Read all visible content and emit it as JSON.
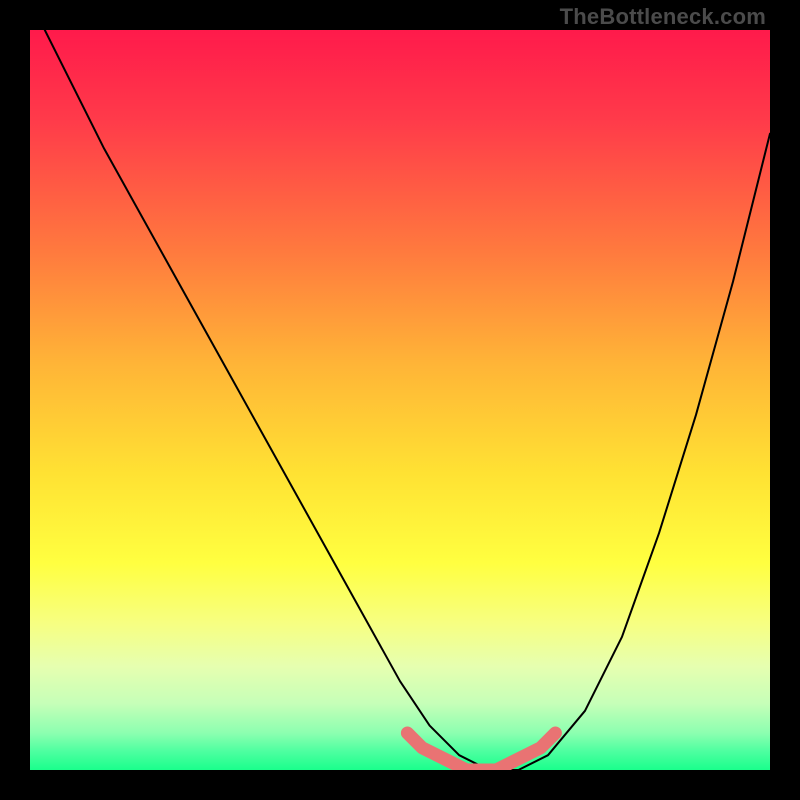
{
  "watermark": "TheBottleneck.com",
  "chart_data": {
    "type": "line",
    "title": "",
    "xlabel": "",
    "ylabel": "",
    "xlim": [
      0,
      100
    ],
    "ylim": [
      0,
      100
    ],
    "grid": false,
    "legend": false,
    "background_gradient_stops": [
      {
        "offset": 0.0,
        "color": "#ff1a4b"
      },
      {
        "offset": 0.12,
        "color": "#ff3a4a"
      },
      {
        "offset": 0.3,
        "color": "#ff7a3e"
      },
      {
        "offset": 0.45,
        "color": "#ffb437"
      },
      {
        "offset": 0.6,
        "color": "#ffe233"
      },
      {
        "offset": 0.72,
        "color": "#ffff40"
      },
      {
        "offset": 0.8,
        "color": "#f7ff80"
      },
      {
        "offset": 0.86,
        "color": "#e6ffb0"
      },
      {
        "offset": 0.91,
        "color": "#c6ffb8"
      },
      {
        "offset": 0.95,
        "color": "#8cffb0"
      },
      {
        "offset": 0.975,
        "color": "#4dffa0"
      },
      {
        "offset": 1.0,
        "color": "#1aff8c"
      }
    ],
    "series": [
      {
        "name": "bottleneck-curve",
        "style": "thin-black-line",
        "x": [
          2,
          10,
          20,
          30,
          40,
          50,
          54,
          58,
          62,
          66,
          70,
          75,
          80,
          85,
          90,
          95,
          100
        ],
        "y": [
          100,
          84,
          66,
          48,
          30,
          12,
          6,
          2,
          0,
          0,
          2,
          8,
          18,
          32,
          48,
          66,
          86
        ]
      },
      {
        "name": "optimal-range-marker",
        "style": "thick-pink-line",
        "x": [
          51,
          53,
          55,
          57,
          59,
          61,
          63,
          65,
          67,
          69,
          71
        ],
        "y": [
          5,
          3,
          2,
          1,
          0,
          0,
          0,
          1,
          2,
          3,
          5
        ]
      }
    ],
    "styles": {
      "thin-black-line": {
        "stroke": "#000000",
        "width": 2,
        "linecap": "round"
      },
      "thick-pink-line": {
        "stroke": "#e97373",
        "width": 13,
        "linecap": "round"
      }
    }
  }
}
